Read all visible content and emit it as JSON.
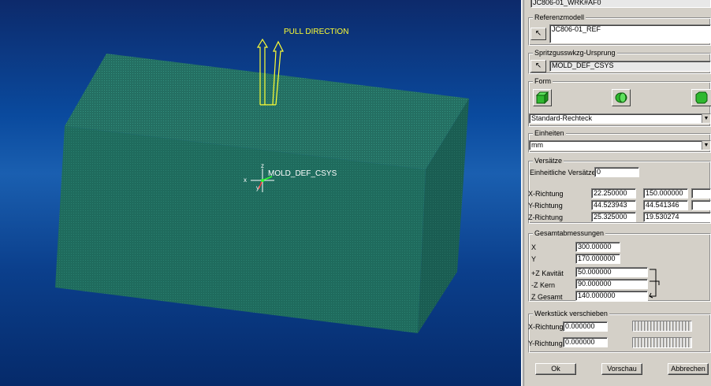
{
  "viewport": {
    "pull_direction_label": "PULL DIRECTION",
    "csys_label": "MOLD_DEF_CSYS",
    "axis_x": "x",
    "axis_y": "y",
    "axis_z": "z",
    "colors": {
      "block_front": "#1e6a5c",
      "block_top": "#24786a",
      "block_side": "#195a50",
      "pull": "#ffff33"
    }
  },
  "panel": {
    "top_field": "JC806-01_WRK#AF0",
    "referenzmodell": {
      "legend": "Referenzmodell",
      "value": "JC806-01_REF",
      "select_icon": "arrow-cursor-icon"
    },
    "ursprung": {
      "legend": "Spritzgusswkzg-Ursprung",
      "value": "MOLD_DEF_CSYS",
      "select_icon": "arrow-cursor-icon"
    },
    "form": {
      "legend": "Form",
      "shapes": [
        "box-shape-icon",
        "cylinder-shape-icon",
        "chamfered-shape-icon"
      ],
      "selected": "Standard-Rechteck"
    },
    "einheiten": {
      "legend": "Einheiten",
      "selected": "mm"
    },
    "versaetze": {
      "legend": "Versätze",
      "einheitlich_label": "Einheitliche Versätze",
      "einheitlich_value": "0",
      "rows": [
        {
          "label": "X-Richtung",
          "v1": "22.250000",
          "v2": "150.000000",
          "v3": ""
        },
        {
          "label": "Y-Richtung",
          "v1": "44.523943",
          "v2": "44.541346",
          "v3": ""
        },
        {
          "label": "Z-Richtung",
          "v1": "25.325000",
          "v2": "19.530274",
          "v3": ""
        }
      ]
    },
    "gesamt": {
      "legend": "Gesamtabmessungen",
      "rows": [
        {
          "label": "X",
          "value": "300.00000"
        },
        {
          "label": "Y",
          "value": "170.000000"
        },
        {
          "label": "+Z Kavität",
          "value": "50.000000"
        },
        {
          "label": "-Z Kern",
          "value": "90.000000"
        },
        {
          "label": "Z Gesamt",
          "value": "140.000000"
        }
      ]
    },
    "verschieben": {
      "legend": "Werkstück verschieben",
      "rows": [
        {
          "label": "X-Richtung",
          "value": "0.000000"
        },
        {
          "label": "Y-Richtung",
          "value": "0.000000"
        }
      ]
    },
    "buttons": {
      "ok": "Ok",
      "preview": "Vorschau",
      "cancel": "Abbrechen"
    }
  }
}
